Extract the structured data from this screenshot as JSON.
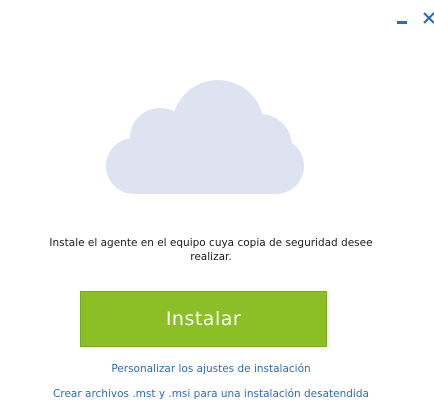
{
  "window": {
    "minimize_icon": "minimize-icon",
    "close_icon": "close-icon",
    "accent_color": "#2e6db4"
  },
  "illustration": {
    "icon": "cloud-icon",
    "color": "#dde3f0"
  },
  "message": {
    "line1": "Instale el agente en el equipo cuya copia de seguridad desee",
    "line2": "realizar."
  },
  "install_button": {
    "label": "Instalar",
    "color": "#8cbf26"
  },
  "links": {
    "customize": "Personalizar los ajustes de instalación",
    "mst_msi": "Crear archivos .mst y .msi para una instalación desatendida"
  }
}
